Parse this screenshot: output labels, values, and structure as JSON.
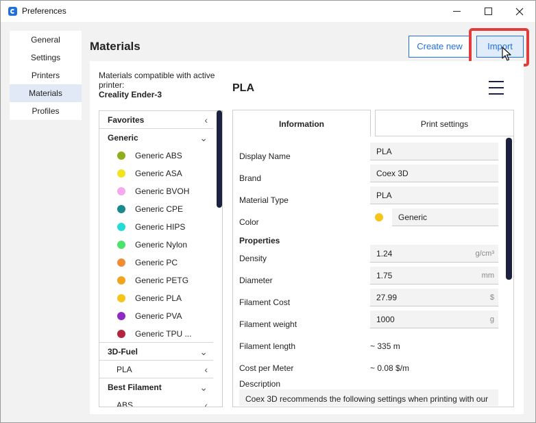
{
  "window": {
    "title": "Preferences",
    "icon": "cura-app-icon"
  },
  "nav": {
    "items": [
      {
        "label": "General",
        "active": false
      },
      {
        "label": "Settings",
        "active": false
      },
      {
        "label": "Printers",
        "active": false
      },
      {
        "label": "Materials",
        "active": true
      },
      {
        "label": "Profiles",
        "active": false
      }
    ]
  },
  "page": {
    "title": "Materials",
    "create_label": "Create new",
    "import_label": "Import"
  },
  "compat": {
    "prefix": "Materials compatible with active printer:",
    "printer": "Creality Ender-3"
  },
  "tree": {
    "favorites": "Favorites",
    "generic": "Generic",
    "generic_items": [
      {
        "label": "Generic ABS",
        "color": "#8fae1b"
      },
      {
        "label": "Generic ASA",
        "color": "#f2e21f"
      },
      {
        "label": "Generic BVOH",
        "color": "#f6a9ef"
      },
      {
        "label": "Generic CPE",
        "color": "#18898f"
      },
      {
        "label": "Generic HIPS",
        "color": "#22dcd8"
      },
      {
        "label": "Generic Nylon",
        "color": "#4be36b"
      },
      {
        "label": "Generic PC",
        "color": "#f28c34"
      },
      {
        "label": "Generic PETG",
        "color": "#f2a41c"
      },
      {
        "label": "Generic PLA",
        "color": "#f7c519"
      },
      {
        "label": "Generic PVA",
        "color": "#8e2bc4"
      },
      {
        "label": "Generic TPU ...",
        "color": "#b3243f"
      }
    ],
    "fuel": "3D-Fuel",
    "fuel_sub": "PLA",
    "best": "Best Filament",
    "best_sub": "ABS"
  },
  "material": {
    "title": "PLA",
    "tab_info": "Information",
    "tab_print": "Print settings",
    "labels": {
      "display_name": "Display Name",
      "brand": "Brand",
      "material_type": "Material Type",
      "color": "Color",
      "properties": "Properties",
      "density": "Density",
      "diameter": "Diameter",
      "filament_cost": "Filament Cost",
      "filament_weight": "Filament weight",
      "filament_length": "Filament length",
      "cost_per_meter": "Cost per Meter",
      "description": "Description"
    },
    "values": {
      "display_name": "PLA",
      "brand": "Coex 3D",
      "material_type": "PLA",
      "color_name": "Generic",
      "color_hex": "#f7c519",
      "density": "1.24",
      "density_unit": "g/cm³",
      "diameter": "1.75",
      "diameter_unit": "mm",
      "filament_cost": "27.99",
      "cost_unit": "$",
      "filament_weight": "1000",
      "weight_unit": "g",
      "filament_length": "~ 335 m",
      "cost_per_meter": "~ 0.08 $/m",
      "description": "Coex 3D recommends the following settings when printing with our"
    }
  }
}
